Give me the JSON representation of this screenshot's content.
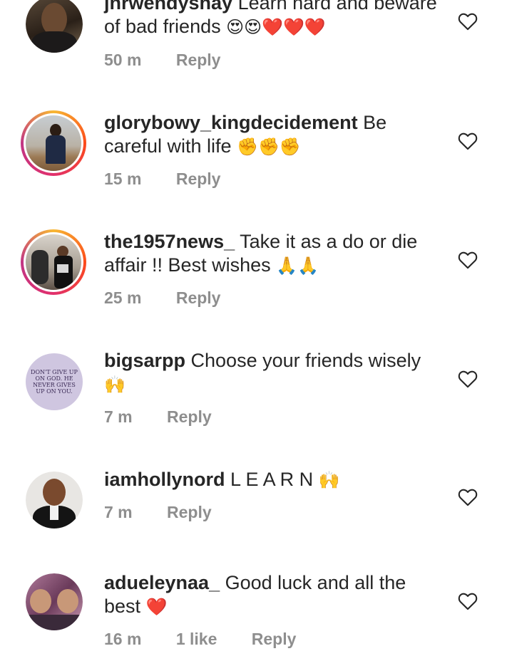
{
  "comments": [
    {
      "username": "jnrwendyshay",
      "text": "Learn hard and beware of bad friends",
      "emoji": "😍😍❤️❤️❤️",
      "time": "50 m",
      "likes": "",
      "reply_label": "Reply"
    },
    {
      "username": "glorybowy_kingdecidement",
      "text": "Be careful with life",
      "emoji": "✊✊✊",
      "time": "15 m",
      "likes": "",
      "reply_label": "Reply"
    },
    {
      "username": "the1957news_",
      "text": "Take it as a do or die affair !! Best wishes",
      "emoji": "🙏🙏",
      "time": "25 m",
      "likes": "",
      "reply_label": "Reply"
    },
    {
      "username": "bigsarpp",
      "text": "Choose your friends wisely",
      "emoji": "🙌",
      "time": "7 m",
      "likes": "",
      "reply_label": "Reply",
      "avatar_text": "DON'T GIVE UP ON GOD. HE NEVER GIVES UP ON YOU."
    },
    {
      "username": "iamhollynord",
      "text": "L E A R N",
      "emoji": "🙌",
      "time": "7 m",
      "likes": "",
      "reply_label": "Reply"
    },
    {
      "username": "adueleynaa_",
      "text": "Good luck and all the best",
      "emoji": "❤️",
      "time": "16 m",
      "likes": "1 like",
      "reply_label": "Reply"
    }
  ],
  "colors": {
    "text": "#262626",
    "meta": "#8e8e8e",
    "heart_outline": "#262626"
  },
  "icons": {
    "like": "heart-outline-icon"
  }
}
